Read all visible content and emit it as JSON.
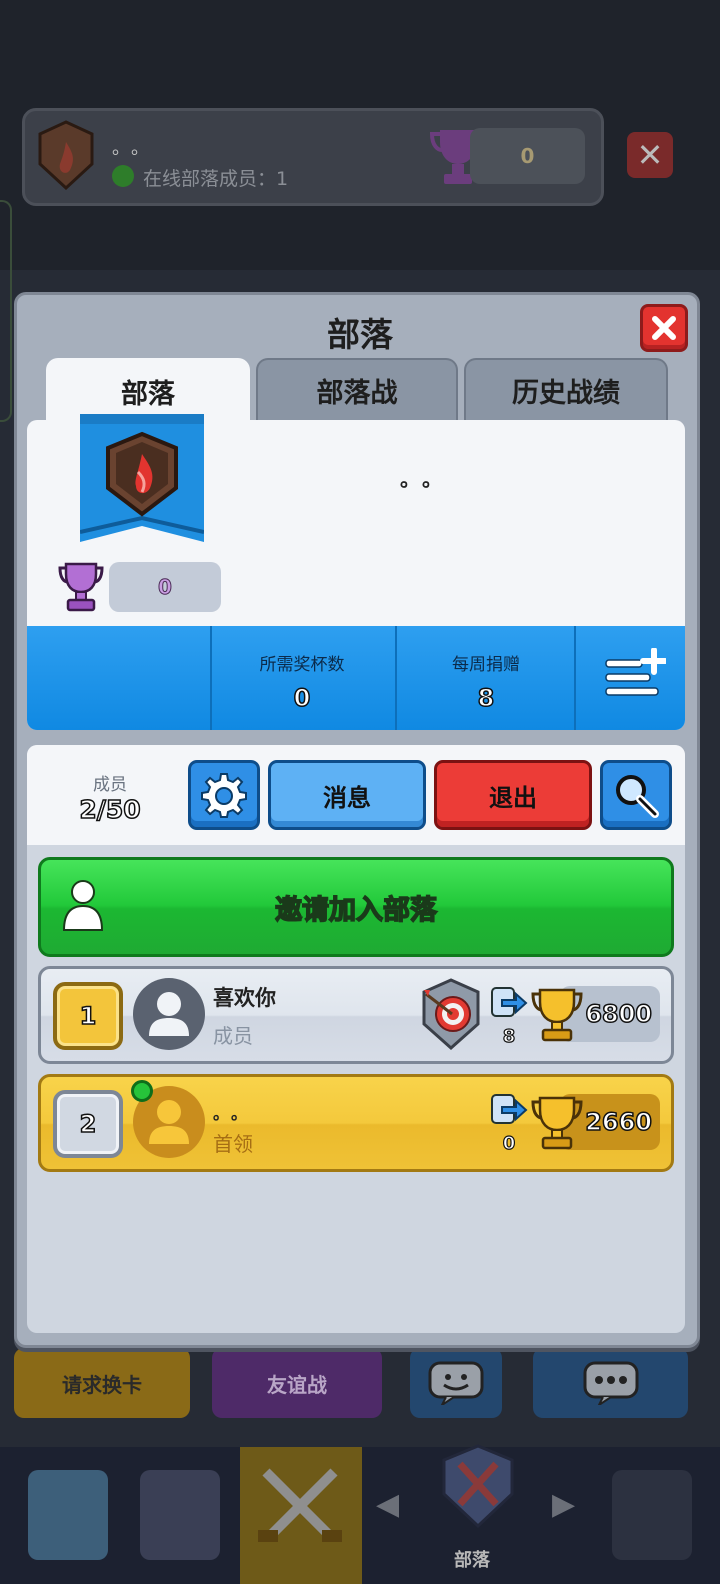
{
  "background": {
    "clan_name": "。。",
    "online_members": "在线部落成员：1",
    "trophies": "0",
    "action_buttons": [
      "请求换卡",
      "友谊战"
    ],
    "nav_label": "部落"
  },
  "dialog": {
    "title": "部落",
    "tabs": [
      "部落",
      "部落战",
      "历史战绩"
    ],
    "clan_name": "。。",
    "clan_trophies": "0",
    "stats": {
      "required_trophies_label": "所需奖杯数",
      "required_trophies": "0",
      "weekly_donations_label": "每周捐赠",
      "weekly_donations": "8"
    },
    "members": {
      "label": "成员",
      "count": "2/50",
      "message_button": "消息",
      "exit_button": "退出"
    },
    "invite_label": "邀请加入部落",
    "member_list": [
      {
        "rank": "1",
        "name": "喜欢你",
        "role": "成员",
        "donations": "8",
        "trophies": "6800",
        "online": false
      },
      {
        "rank": "2",
        "name": "。。",
        "role": "首领",
        "donations": "0",
        "trophies": "2660",
        "online": true
      }
    ]
  },
  "colors": {
    "accent_blue": "#1089e2",
    "exit_red": "#ec3c37",
    "invite_green": "#22c93a",
    "leader_gold": "#f4c93c"
  }
}
